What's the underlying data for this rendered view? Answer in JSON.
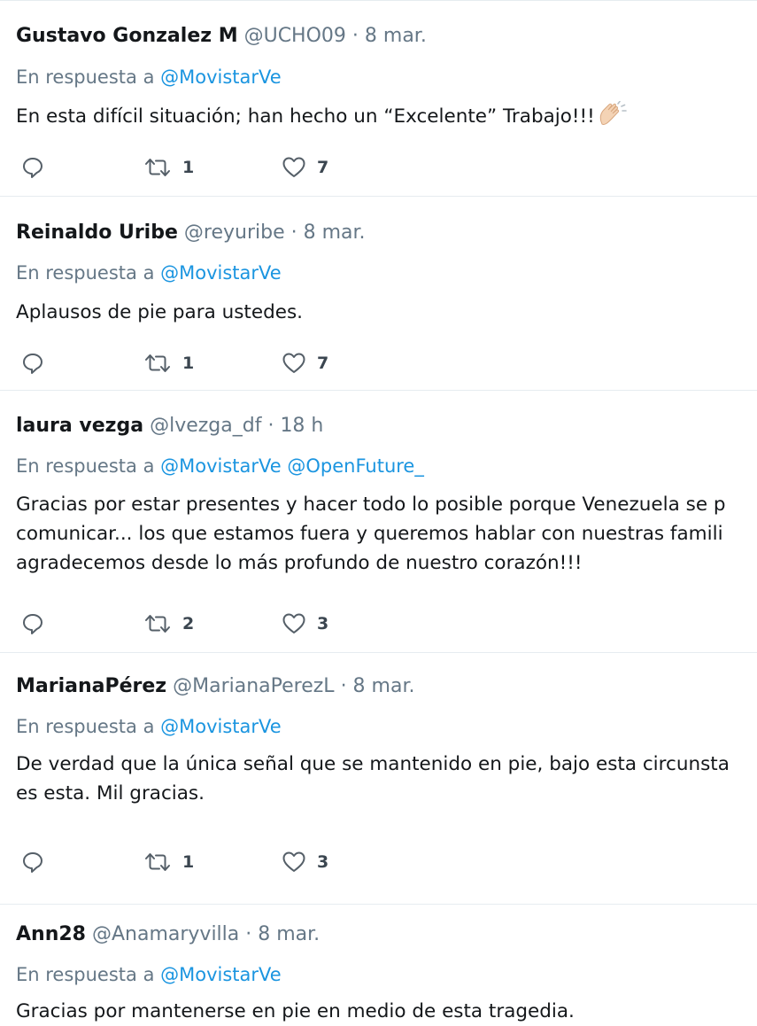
{
  "tweets": [
    {
      "name": "Gustavo Gonzalez M",
      "handle": "@UCHO09",
      "time": "· 8 mar.",
      "reply_prefix": "En respuesta a",
      "mentions": [
        "@MovistarVe"
      ],
      "lines": [
        "En esta difícil situación; han hecho un “Excelente” Trabajo!!!"
      ],
      "emoji": "clapping-hands",
      "retweets": "1",
      "likes": "7"
    },
    {
      "name": "Reinaldo Uribe",
      "handle": "@reyuribe",
      "time": "· 8 mar.",
      "reply_prefix": "En respuesta a",
      "mentions": [
        "@MovistarVe"
      ],
      "lines": [
        "Aplausos de pie para ustedes."
      ],
      "retweets": "1",
      "likes": "7"
    },
    {
      "name": "laura vezga",
      "handle": "@lvezga_df",
      "time": "· 18 h",
      "reply_prefix": "En respuesta a",
      "mentions": [
        "@MovistarVe",
        "@OpenFuture_"
      ],
      "lines": [
        "Gracias por estar presentes y hacer todo lo posible porque Venezuela se p",
        "comunicar... los que estamos fuera y queremos hablar con nuestras famili",
        "agradecemos desde lo más profundo de nuestro corazón!!!"
      ],
      "retweets": "2",
      "likes": "3"
    },
    {
      "name": "MarianaPérez",
      "handle": "@MarianaPerezL",
      "time": "· 8 mar.",
      "reply_prefix": "En respuesta a",
      "mentions": [
        "@MovistarVe"
      ],
      "lines": [
        "De verdad que la única señal que se mantenido en pie, bajo esta circunsta",
        "es esta. Mil gracias."
      ],
      "retweets": "1",
      "likes": "3"
    },
    {
      "name": "Ann28",
      "handle": "@Anamaryvilla",
      "time": "· 8 mar.",
      "reply_prefix": "En respuesta a",
      "mentions": [
        "@MovistarVe"
      ],
      "lines": [
        "Gracias por mantenerse en pie en medio de esta tragedia."
      ]
    }
  ],
  "icons": {
    "reply": "reply-icon",
    "retweet": "retweet-icon",
    "like": "heart-icon"
  },
  "colors": {
    "mention": "#1b95e0",
    "meta": "#657786",
    "text": "#14171a",
    "divider": "#e6ecf0"
  }
}
